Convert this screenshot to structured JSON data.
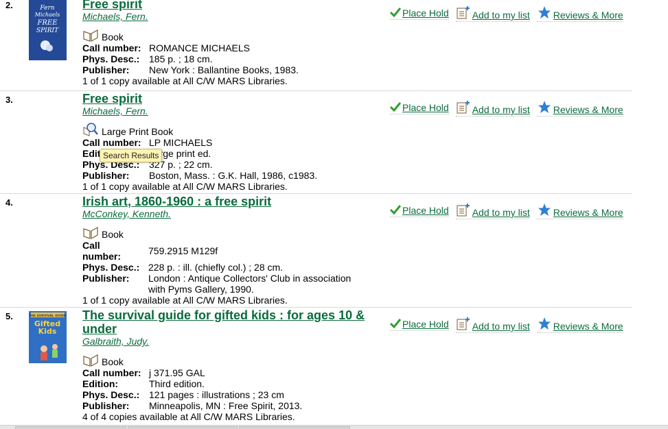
{
  "results": [
    {
      "number": "2.",
      "title": "Free spirit",
      "author": "Michaels, Fern.",
      "format": "Book",
      "format_icon": "book-icon",
      "has_cover": true,
      "cover_text": [
        "Fern",
        "Michaels",
        "FREE",
        "SPIRIT"
      ],
      "fields": [
        {
          "label": "Call number:",
          "value": "ROMANCE MICHAELS"
        },
        {
          "label": "Phys. Desc.:",
          "value": "185 p. ; 18 cm."
        },
        {
          "label": "Publisher:",
          "value": "New York : Ballantine Books, 1983."
        }
      ],
      "availability": "1 of 1 copy available at All C/W MARS Libraries."
    },
    {
      "number": "3.",
      "title": "Free spirit",
      "author": "Michaels, Fern.",
      "format": "Large Print Book",
      "format_icon": "magnifier-book-icon",
      "has_cover": false,
      "fields": [
        {
          "label": "Call number:",
          "value": "LP MICHAELS"
        },
        {
          "label": "Edition:",
          "value": "Large print ed."
        },
        {
          "label": "Phys. Desc.:",
          "value": "327 p. ; 22 cm."
        },
        {
          "label": "Publisher:",
          "value": "Boston, Mass. : G.K. Hall, 1986, c1983."
        }
      ],
      "availability": "1 of 1 copy available at All C/W MARS Libraries."
    },
    {
      "number": "4.",
      "title": "Irish art, 1860-1960 : a free spirit",
      "author": "McConkey, Kenneth.",
      "format": "Book",
      "format_icon": "book-icon",
      "has_cover": false,
      "fields": [
        {
          "label": "Call number:",
          "value": "759.2915 M129f"
        },
        {
          "label": "Phys. Desc.:",
          "value": "228 p. : ill. (chiefly col.) ; 28 cm."
        },
        {
          "label": "Publisher:",
          "value": "London : Antique Collectors' Club in association with Pyms Gallery, 1990."
        }
      ],
      "availability": "1 of 1 copy available at All C/W MARS Libraries."
    },
    {
      "number": "5.",
      "title": "The survival guide for gifted kids : for ages 10 & under",
      "author": "Galbraith, Judy.",
      "format": "Book",
      "format_icon": "book-icon",
      "has_cover": true,
      "cover_text": [
        "THE SURVIVAL GUIDE",
        "Gifted",
        "Kids"
      ],
      "fields": [
        {
          "label": "Call number:",
          "value": "j 371.95 GAL"
        },
        {
          "label": "Edition:",
          "value": "Third edition."
        },
        {
          "label": "Phys. Desc.:",
          "value": "121 pages : illustrations ; 23 cm"
        },
        {
          "label": "Publisher:",
          "value": "Minneapolis, MN : Free Spirit, 2013."
        }
      ],
      "availability": "4 of 4 copies available at All C/W MARS Libraries."
    }
  ],
  "actions": {
    "place_hold": "Place Hold",
    "add_to_list": "Add to my list",
    "reviews": "Reviews & More"
  },
  "tooltip": "Search Results",
  "colors": {
    "link": "#0a6b3c",
    "tooltip_bg": "#fff4b3",
    "check": "#2e9e2e",
    "star": "#2f7fd8"
  }
}
